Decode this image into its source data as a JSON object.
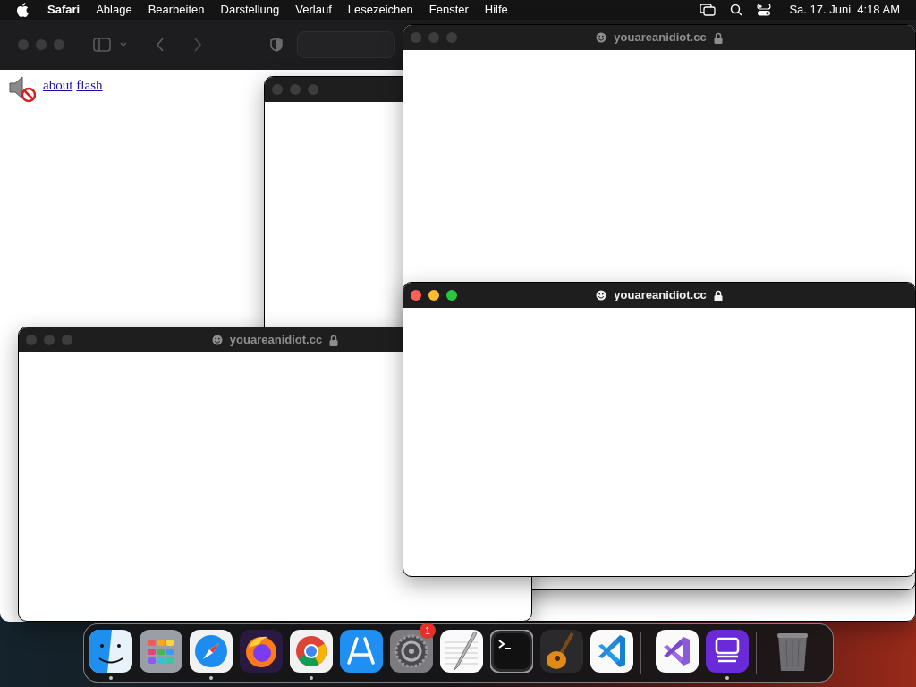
{
  "menu_bar": {
    "app": "Safari",
    "menus": [
      "Ablage",
      "Bearbeiten",
      "Darstellung",
      "Verlauf",
      "Lesezeichen",
      "Fenster",
      "Hilfe"
    ],
    "clock": "Sa. 17. Juni  4:18 AM"
  },
  "page": {
    "links": [
      "about",
      "flash"
    ]
  },
  "windows": [
    {
      "active": false
    },
    {
      "title": "youareanidiot.cc",
      "active": false
    },
    {
      "title": "youareanidiot.cc",
      "active": false
    },
    {
      "title": "youareanidiot.cc",
      "active": true
    }
  ],
  "dock": {
    "items": [
      {
        "running": true
      },
      {
        "running": false
      },
      {
        "running": true
      },
      {
        "running": false
      },
      {
        "running": true
      },
      {
        "running": false
      },
      {
        "running": false,
        "badge": "1"
      },
      {
        "running": false
      },
      {
        "running": false
      },
      {
        "running": false
      },
      {
        "running": false,
        "separator_after": true
      },
      {
        "running": false
      },
      {
        "running": true,
        "separator_after": true
      },
      {
        "running": false
      }
    ]
  }
}
